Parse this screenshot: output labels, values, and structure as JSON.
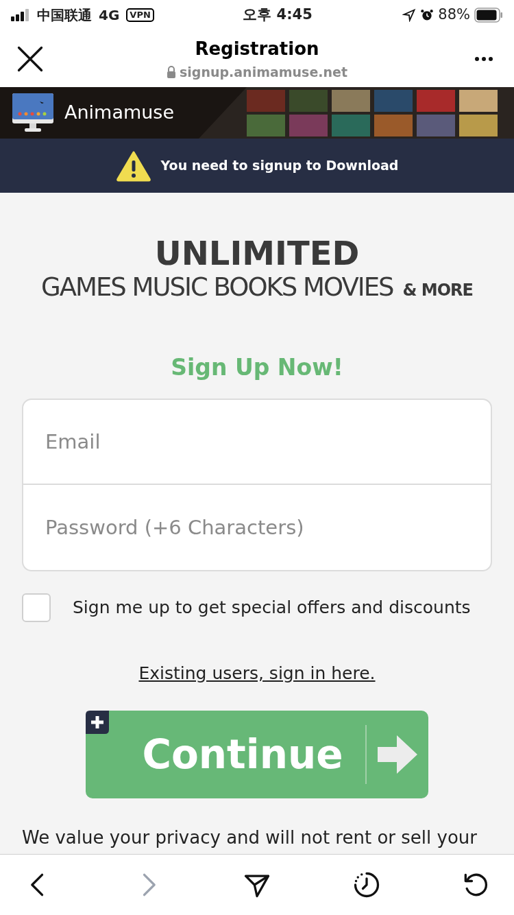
{
  "status_bar": {
    "carrier": "中国联通",
    "network": "4G",
    "vpn": "VPN",
    "time": "오후 4:45",
    "battery": "88%"
  },
  "nav": {
    "title": "Registration",
    "url": "signup.animamuse.net"
  },
  "banner": {
    "brand": "Animamuse",
    "alert": "You need to signup to Download"
  },
  "headline": {
    "main": "UNLIMITED",
    "sub": "GAMES MUSIC BOOKS MOVIES",
    "more": "& MORE"
  },
  "form": {
    "title": "Sign Up Now!",
    "fields": [
      {
        "placeholder": "Email"
      },
      {
        "placeholder": "Password (+6 Characters)"
      }
    ],
    "offers": {
      "label": "Sign me up to get special offers and discounts",
      "checked": false
    },
    "signin_link": "Existing users, sign in here.",
    "button": "Continue",
    "privacy": "We value your privacy and will not rent or sell your"
  },
  "toolbar": [
    {
      "kind": "back",
      "disabled": false
    },
    {
      "kind": "forward",
      "disabled": true
    },
    {
      "kind": "share",
      "disabled": false
    },
    {
      "kind": "history",
      "disabled": false
    },
    {
      "kind": "reload",
      "disabled": false
    }
  ]
}
